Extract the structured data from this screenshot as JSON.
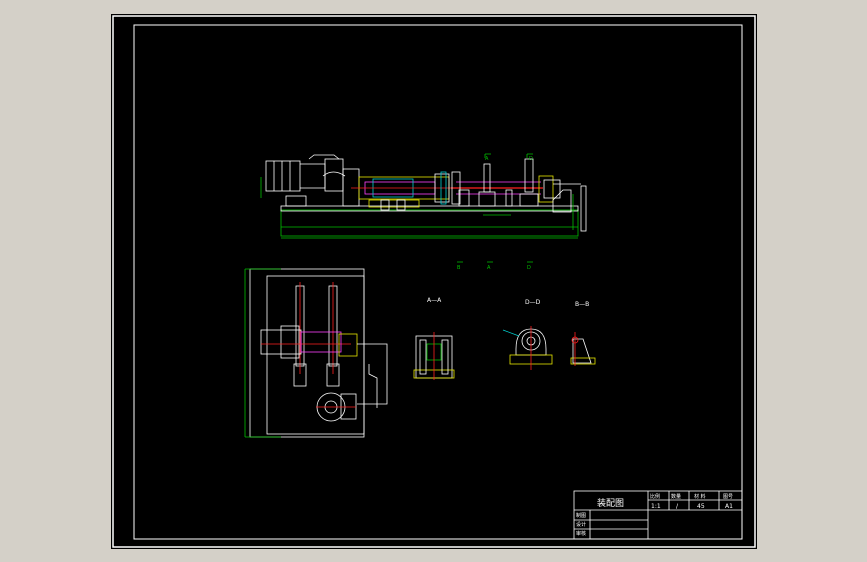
{
  "title_block": {
    "drawing_name": "装配图",
    "col_headers": [
      "比例",
      "数量",
      "材 料",
      "图号"
    ],
    "values": [
      "1:1",
      "/",
      "45",
      "A1"
    ],
    "row_labels": [
      "制图",
      "设计",
      "审核"
    ]
  },
  "section_labels": {
    "a_a": "A—A",
    "d_d": "D—D",
    "b_b": "B—B"
  },
  "colors": {
    "background": "#000000",
    "outer_frame": "#ffffff",
    "outline": "#ffffff",
    "dim_green": "#00c000",
    "part_yellow": "#e8e800",
    "center_red": "#ff2020",
    "part_magenta": "#ff40ff",
    "part_cyan": "#00d0d0"
  }
}
